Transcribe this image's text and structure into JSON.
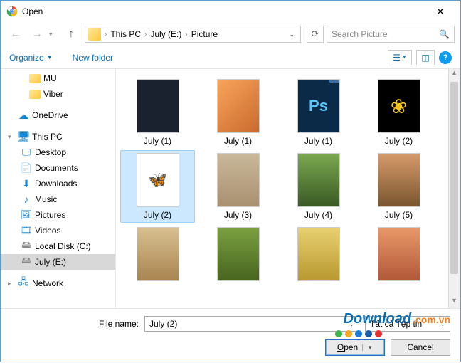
{
  "window": {
    "title": "Open"
  },
  "nav": {
    "crumbs": [
      "This PC",
      "July (E:)",
      "Picture"
    ],
    "search_placeholder": "Search Picture"
  },
  "toolbar": {
    "organize": "Organize",
    "newfolder": "New folder"
  },
  "sidebar": [
    {
      "icon": "folder",
      "label": "MU",
      "indent": 2
    },
    {
      "icon": "folder",
      "label": "Viber",
      "indent": 2
    },
    {
      "icon": "onedrive",
      "label": "OneDrive",
      "indent": 0,
      "expand": ""
    },
    {
      "icon": "thispc",
      "label": "This PC",
      "indent": 0,
      "expand": "▾"
    },
    {
      "icon": "desktop",
      "label": "Desktop",
      "indent": 1
    },
    {
      "icon": "docs",
      "label": "Documents",
      "indent": 1
    },
    {
      "icon": "down",
      "label": "Downloads",
      "indent": 1
    },
    {
      "icon": "music",
      "label": "Music",
      "indent": 1
    },
    {
      "icon": "pics",
      "label": "Pictures",
      "indent": 1
    },
    {
      "icon": "videos",
      "label": "Videos",
      "indent": 1
    },
    {
      "icon": "disk",
      "label": "Local Disk (C:)",
      "indent": 1
    },
    {
      "icon": "disk",
      "label": "July (E:)",
      "indent": 1,
      "selected": true
    },
    {
      "icon": "net",
      "label": "Network",
      "indent": 0,
      "expand": "▸"
    }
  ],
  "files": [
    {
      "label": "July (1)",
      "cls": "th-dark"
    },
    {
      "label": "July (1)",
      "cls": "th-sunset"
    },
    {
      "label": "July (1)",
      "cls": "th-ps",
      "ps": true
    },
    {
      "label": "July (2)",
      "cls": "th-flower"
    },
    {
      "label": "July (2)",
      "cls": "th-wings",
      "selected": true,
      "glyph": "🦋"
    },
    {
      "label": "July (3)",
      "cls": "th-cat"
    },
    {
      "label": "July (4)",
      "cls": "th-monkey"
    },
    {
      "label": "July (5)",
      "cls": "th-girl"
    },
    {
      "label": "",
      "cls": "th-kid"
    },
    {
      "label": "",
      "cls": "th-green"
    },
    {
      "label": "",
      "cls": "th-field"
    },
    {
      "label": "",
      "cls": "th-blur"
    }
  ],
  "bottom": {
    "filename_label": "File name:",
    "filename_value": "July (2)",
    "filetype_value": "Tất cả Tệp tin",
    "open": "Open",
    "cancel": "Cancel"
  },
  "watermark": {
    "main": "Download",
    "suffix": ".com.vn"
  }
}
